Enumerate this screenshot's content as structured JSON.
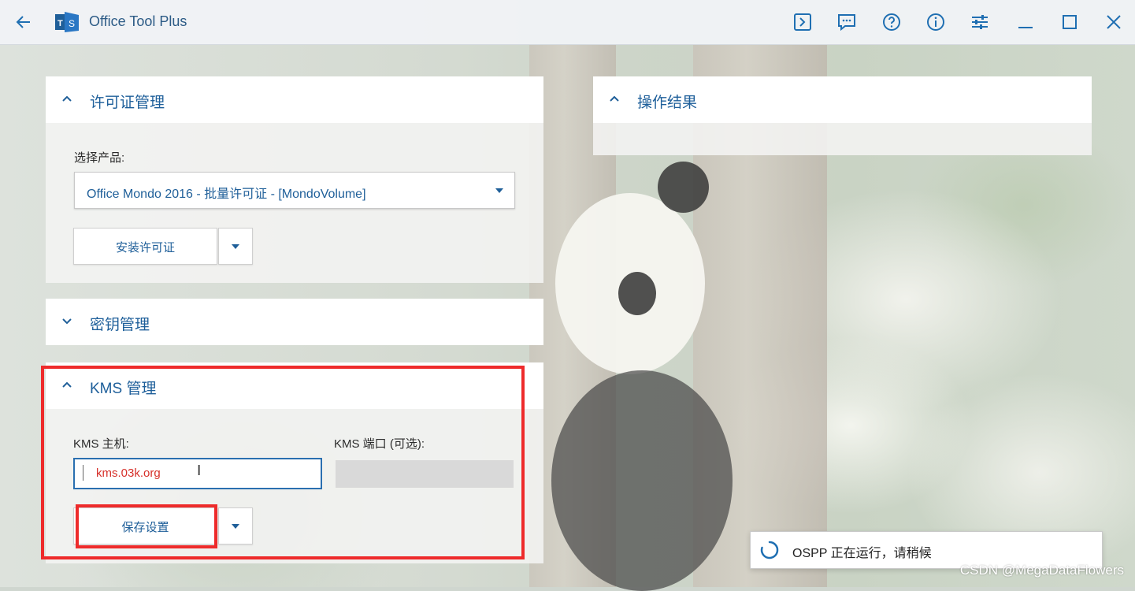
{
  "window": {
    "title": "Office Tool Plus",
    "toolbar_icons": [
      "console-icon",
      "feedback-icon",
      "help-icon",
      "info-icon",
      "settings-sliders-icon",
      "minimize-icon",
      "maximize-icon",
      "close-icon"
    ]
  },
  "license_card": {
    "title": "许可证管理",
    "select_label": "选择产品:",
    "selected_product": "Office Mondo 2016 - 批量许可证 - [MondoVolume]",
    "install_button": "安装许可证"
  },
  "key_card": {
    "title": "密钥管理"
  },
  "kms_card": {
    "title": "KMS 管理",
    "host_label": "KMS 主机:",
    "host_value": "kms.03k.org",
    "port_label": "KMS 端口 (可选):",
    "port_value": "",
    "save_button": "保存设置"
  },
  "results_card": {
    "title": "操作结果"
  },
  "status_toast": {
    "text": "OSPP 正在运行，请稍候"
  },
  "watermark": "CSDN @MegaDataFlowers",
  "colors": {
    "accent": "#1f6fb2",
    "highlight": "#ee2b2b",
    "input_text": "#d6302a"
  }
}
